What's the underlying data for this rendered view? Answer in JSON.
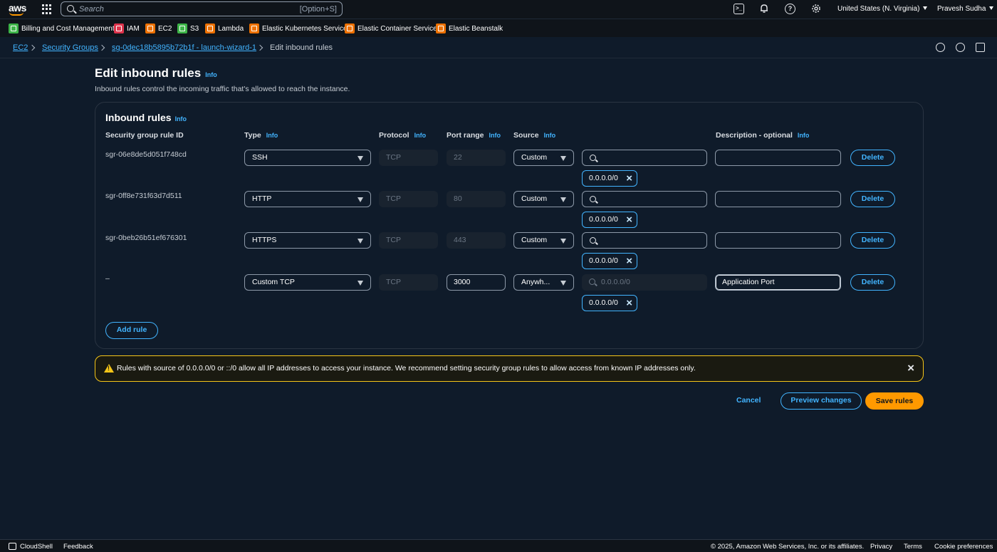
{
  "topbar": {
    "logo": "aws",
    "search_placeholder": "Search",
    "search_shortcut": "[Option+S]",
    "region": "United States (N. Virginia)",
    "user": "Pravesh Sudha",
    "icons": [
      "grid-icon",
      "cloudshell-icon",
      "bell-icon",
      "help-icon",
      "gear-icon"
    ]
  },
  "favorites": [
    {
      "label": "Billing and Cost Management",
      "color": "#3eb549"
    },
    {
      "label": "IAM",
      "color": "#dd344c"
    },
    {
      "label": "EC2",
      "color": "#ed7100"
    },
    {
      "label": "S3",
      "color": "#3eb549"
    },
    {
      "label": "Lambda",
      "color": "#ed7100"
    },
    {
      "label": "Elastic Kubernetes Service",
      "color": "#ed7100"
    },
    {
      "label": "Elastic Container Service",
      "color": "#ed7100"
    },
    {
      "label": "Elastic Beanstalk",
      "color": "#ed7100"
    }
  ],
  "breadcrumb": {
    "items": [
      "EC2",
      "Security Groups",
      "sg-0dec18b5895b72b1f - launch-wizard-1"
    ],
    "current": "Edit inbound rules"
  },
  "page": {
    "title": "Edit inbound rules",
    "info": "Info",
    "description": "Inbound rules control the incoming traffic that's allowed to reach the instance."
  },
  "panel": {
    "title": "Inbound rules",
    "columns": {
      "rule_id": "Security group rule ID",
      "type": "Type",
      "protocol": "Protocol",
      "port_range": "Port range",
      "source": "Source",
      "description": "Description - optional"
    },
    "rules": [
      {
        "id": "sgr-06e8de5d051f748cd",
        "type": "SSH",
        "protocol": "TCP",
        "port": "22",
        "source": "Custom",
        "cidr_placeholder": "",
        "token": "0.0.0.0/0",
        "description": "",
        "delete": "Delete"
      },
      {
        "id": "sgr-0ff8e731f63d7d511",
        "type": "HTTP",
        "protocol": "TCP",
        "port": "80",
        "source": "Custom",
        "cidr_placeholder": "",
        "token": "0.0.0.0/0",
        "description": "",
        "delete": "Delete"
      },
      {
        "id": "sgr-0beb26b51ef676301",
        "type": "HTTPS",
        "protocol": "TCP",
        "port": "443",
        "source": "Custom",
        "cidr_placeholder": "",
        "token": "0.0.0.0/0",
        "description": "",
        "delete": "Delete"
      },
      {
        "id": "–",
        "type": "Custom TCP",
        "protocol": "TCP",
        "port": "3000",
        "source": "Anywh...",
        "cidr_placeholder": "0.0.0.0/0",
        "token": "0.0.0.0/0",
        "description": "Application Port",
        "delete": "Delete"
      }
    ],
    "add_rule": "Add rule"
  },
  "alert": {
    "text": "Rules with source of 0.0.0.0/0 or ::/0 allow all IP addresses to access your instance. We recommend setting security group rules to allow access from known IP addresses only."
  },
  "actions": {
    "cancel": "Cancel",
    "preview": "Preview changes",
    "save": "Save rules"
  },
  "footer": {
    "cloudshell": "CloudShell",
    "feedback": "Feedback",
    "copyright": "© 2025, Amazon Web Services, Inc. or its affiliates.",
    "privacy": "Privacy",
    "terms": "Terms",
    "cookies": "Cookie preferences"
  }
}
